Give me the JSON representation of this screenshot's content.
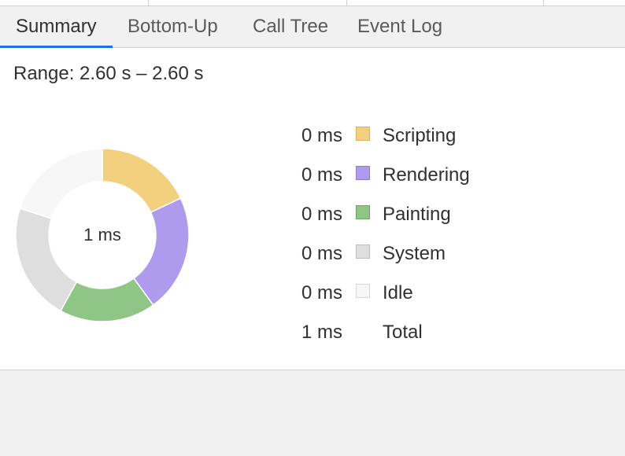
{
  "tabs": [
    {
      "label": "Summary",
      "active": true
    },
    {
      "label": "Bottom-Up",
      "active": false
    },
    {
      "label": "Call Tree",
      "active": false
    },
    {
      "label": "Event Log",
      "active": false
    }
  ],
  "summary": {
    "range_label": "Range: 2.60 s – 2.60 s",
    "donut_center": "1 ms",
    "legend": [
      {
        "value": "0 ms",
        "name": "Scripting",
        "color": "#f2d07e",
        "border": "#d9b45c"
      },
      {
        "value": "0 ms",
        "name": "Rendering",
        "color": "#af9bed",
        "border": "#8f78d6"
      },
      {
        "value": "0 ms",
        "name": "Painting",
        "color": "#8fc585",
        "border": "#6ea664"
      },
      {
        "value": "0 ms",
        "name": "System",
        "color": "#dedede",
        "border": "#bdbdbd"
      },
      {
        "value": "0 ms",
        "name": "Idle",
        "color": "#f7f7f7",
        "border": "#d6d6d6"
      },
      {
        "value": "1 ms",
        "name": "Total",
        "color": "",
        "border": ""
      }
    ],
    "donut_segments": [
      {
        "name": "Scripting",
        "fraction": 0.18,
        "color": "#f2d07e"
      },
      {
        "name": "Rendering",
        "fraction": 0.22,
        "color": "#af9bed"
      },
      {
        "name": "Painting",
        "fraction": 0.18,
        "color": "#8fc585"
      },
      {
        "name": "System",
        "fraction": 0.22,
        "color": "#dedede"
      },
      {
        "name": "Idle",
        "fraction": 0.2,
        "color": "#f7f7f7"
      }
    ]
  }
}
